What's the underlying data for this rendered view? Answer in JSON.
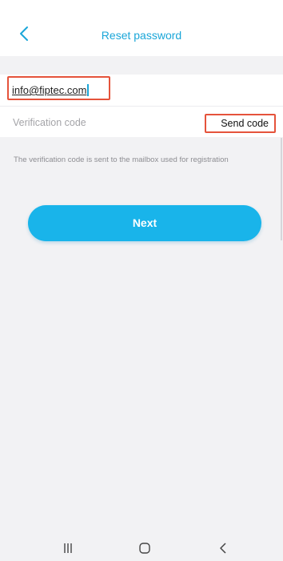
{
  "header": {
    "title": "Reset password",
    "back_icon": "chevron-left-icon"
  },
  "form": {
    "email_value": "info@fiptec.com",
    "code_placeholder": "Verification code",
    "send_code_label": "Send code",
    "hint": "The verification code is sent to the mailbox used for registration",
    "next_label": "Next"
  },
  "nav": {
    "recents_icon": "recents-icon",
    "home_icon": "home-icon",
    "back_icon": "back-icon"
  },
  "colors": {
    "accent": "#1aa6d8",
    "button": "#19b4ea",
    "highlight": "#e5533b"
  }
}
